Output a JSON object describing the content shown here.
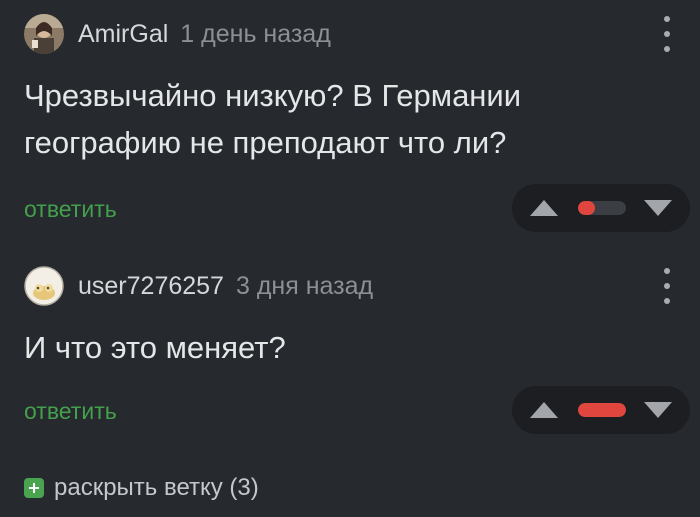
{
  "comments": [
    {
      "username": "AmirGal",
      "time": "1 день назад",
      "text": "Чрезвычайно низкую? В Германии географию не преподают что ли?",
      "reply_label": "ответить",
      "rating_fraction": 0.35,
      "accent_color": "#e0463e"
    },
    {
      "username": "user7276257",
      "time": "3 дня назад",
      "text": "И что это меняет?",
      "reply_label": "ответить",
      "rating_fraction": 1.0,
      "accent_color": "#e0463e"
    }
  ],
  "thread": {
    "expand_label": "раскрыть ветку (3)"
  },
  "theme": {
    "background": "#26292d",
    "reply_color": "#43a04c",
    "expand_icon_color": "#4aa34f"
  },
  "icons": {
    "more": "kebab-vertical",
    "upvote": "triangle-up",
    "downvote": "triangle-down",
    "expand": "plus-square"
  }
}
